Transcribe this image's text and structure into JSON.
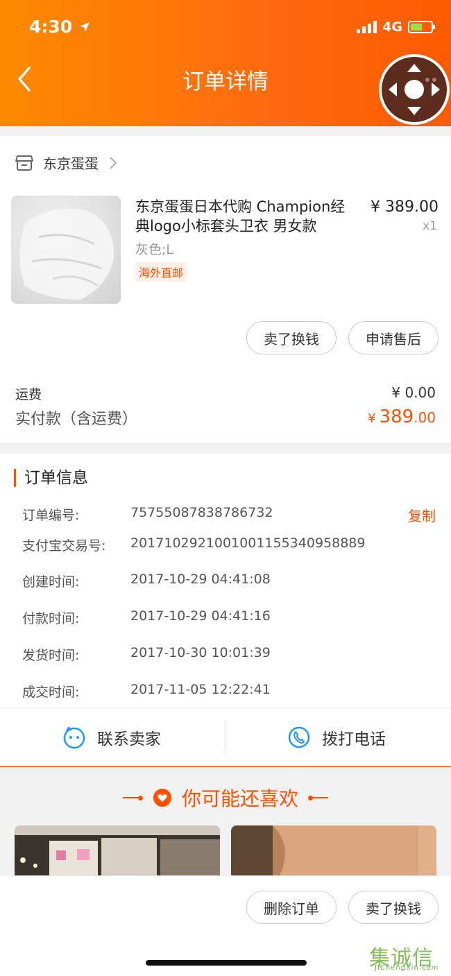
{
  "status_bar": {
    "time": "4:30",
    "network": "4G"
  },
  "header": {
    "title": "订单详情"
  },
  "shop": {
    "name": "东京蛋蛋"
  },
  "product": {
    "title": "东京蛋蛋日本代购  Champion经典logo小标套头卫衣 男女款",
    "spec": "灰色;L",
    "tag": "海外直邮",
    "price": "¥ 389.00",
    "quantity": "x1"
  },
  "item_actions": {
    "sell_label": "卖了换钱",
    "after_sale_label": "申请售后"
  },
  "payment": {
    "shipping_label": "运费",
    "shipping_value": "¥ 0.00",
    "paid_label": "实付款（含运费）",
    "paid_currency": "¥",
    "paid_integer": "389",
    "paid_decimal": ".00"
  },
  "order_info": {
    "title": "订单信息",
    "copy_label": "复制",
    "rows": [
      {
        "label": "订单编号:",
        "value": "75755087838786732"
      },
      {
        "label": "支付宝交易号:",
        "value": "2017102921001001155340958889"
      },
      {
        "label": "创建时间:",
        "value": "2017-10-29 04:41:08"
      },
      {
        "label": "付款时间:",
        "value": "2017-10-29 04:41:16"
      },
      {
        "label": "发货时间:",
        "value": "2017-10-30 10:01:39"
      },
      {
        "label": "成交时间:",
        "value": "2017-11-05 12:22:41"
      }
    ]
  },
  "contact": {
    "seller_label": "联系卖家",
    "phone_label": "拨打电话"
  },
  "recommend": {
    "title": "你可能还喜欢"
  },
  "bottom_actions": {
    "delete_label": "删除订单",
    "sell_label": "卖了换钱"
  },
  "watermark": {
    "logo": "集诚信",
    "url": "JiChengXin.com"
  },
  "colors": {
    "accent": "#ff5000",
    "header_start": "#ff8a00",
    "header_end": "#ff5a00"
  }
}
